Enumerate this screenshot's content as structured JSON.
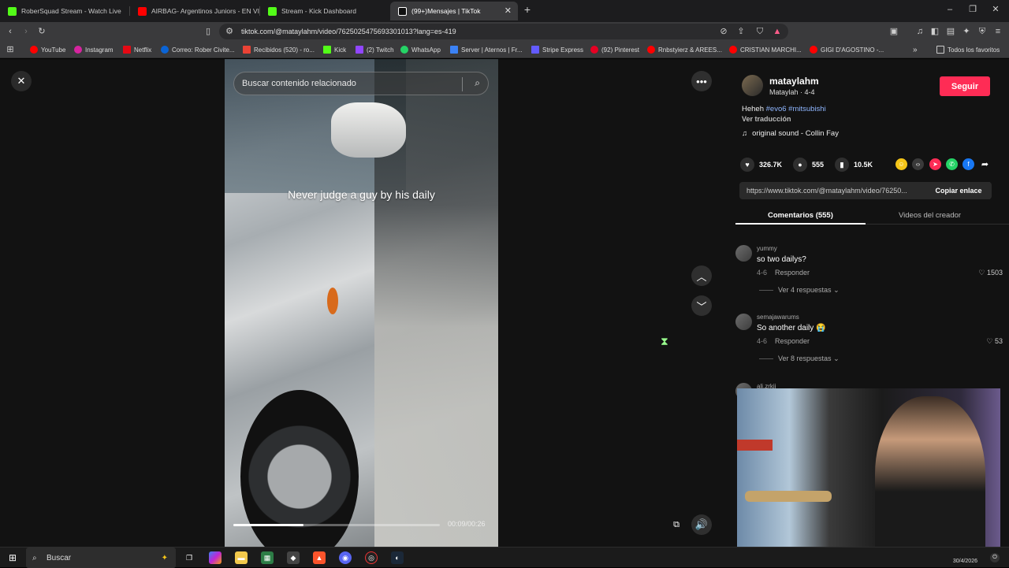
{
  "tabs": [
    {
      "title": "RoberSquad Stream - Watch Live",
      "color": "#53fc18",
      "active": false
    },
    {
      "title": "AIRBAG- Argentinos Juniors - EN VIVO",
      "color": "#ff0000",
      "active": false
    },
    {
      "title": "Stream - Kick Dashboard",
      "color": "#53fc18",
      "active": false
    },
    {
      "title": "(99+)Mensajes | TikTok",
      "color": "#111111",
      "active": true
    }
  ],
  "address": {
    "url": "tiktok.com/@mataylahm/video/7625025475693301013?lang=es-419"
  },
  "bookmarks": [
    {
      "label": "YouTube",
      "color": "#ff0000"
    },
    {
      "label": "Instagram",
      "color": "#d6249f"
    },
    {
      "label": "Netflix",
      "color": "#e50914"
    },
    {
      "label": "Correo: Rober Civite...",
      "color": "#0a64d6"
    },
    {
      "label": "Recibidos (520) - ro...",
      "color": "#ea4335"
    },
    {
      "label": "Kick",
      "color": "#53fc18"
    },
    {
      "label": "(2) Twitch",
      "color": "#9146ff"
    },
    {
      "label": "WhatsApp",
      "color": "#25d366"
    },
    {
      "label": "Server | Aternos | Fr...",
      "color": "#3b82f6"
    },
    {
      "label": "Stripe Express",
      "color": "#635bff"
    },
    {
      "label": "(92) Pinterest",
      "color": "#e60023"
    },
    {
      "label": "Rnbstyierz & AREES...",
      "color": "#ff0000"
    },
    {
      "label": "CRISTIAN MARCHI...",
      "color": "#ff0000"
    },
    {
      "label": "GIGI D'AGOSTINO -...",
      "color": "#ff0000"
    }
  ],
  "bookmarks_more": "»",
  "bookmarks_all": "Todos los favoritos",
  "video": {
    "search_placeholder": "Buscar contenido relacionado",
    "caption": "Never judge a guy by his daily",
    "time": "00:09/00:26",
    "progress": 0.34
  },
  "panel": {
    "username": "mataylahm",
    "subline": "Mataylah · 4-4",
    "follow_label": "Seguir",
    "desc_prefix": "Heheh",
    "tags": [
      "#evo6",
      "#mitsubishi"
    ],
    "translate": "Ver traducción",
    "sound": "original sound - Collin Fay",
    "likes": "326.7K",
    "comments_count": "555",
    "saves": "10.5K",
    "link": "https://www.tiktok.com/@mataylahm/video/76250...",
    "copy_label": "Copiar enlace",
    "tab_comments": "Comentarios (555)",
    "tab_creator": "Videos del creador",
    "share_colors": [
      "#f5c518",
      "#3a3a3a",
      "#fe2c55",
      "#25d366",
      "#1877f2"
    ]
  },
  "comments": [
    {
      "user": "yummy",
      "text": "so two dailys?",
      "date": "4-6",
      "reply": "Responder",
      "likes": "1503",
      "more": "Ver 4 respuestas"
    },
    {
      "user": "semajawarums",
      "text": "So another daily 😭",
      "date": "4-6",
      "reply": "Responder",
      "likes": "53",
      "more": "Ver 8 respuestas"
    },
    {
      "user": "ali.zrkii"
    }
  ],
  "taskbar": {
    "search": "Buscar",
    "date": "30/4/2026"
  }
}
